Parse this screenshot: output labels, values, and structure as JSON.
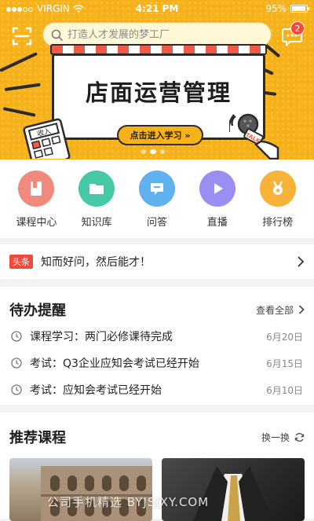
{
  "status_bar": {
    "carrier": "VIRGIN",
    "time": "4:21 PM",
    "battery": "95%",
    "battery_level": 0.95
  },
  "header": {
    "search_placeholder": "打造人才发展的梦工厂",
    "message_badge": "2"
  },
  "banner": {
    "title": "店面运营管理",
    "button_label": "点击进入学习 »",
    "calc_label": "收入",
    "mic_label": "TALK"
  },
  "categories": [
    {
      "label": "课程中心",
      "icon": "course-book-icon",
      "color": "#f08a7e"
    },
    {
      "label": "知识库",
      "icon": "folder-icon",
      "color": "#45c9a6"
    },
    {
      "label": "问答",
      "icon": "chat-bubble-icon",
      "color": "#5fb2ee"
    },
    {
      "label": "直播",
      "icon": "play-icon",
      "color": "#9a8ef2"
    },
    {
      "label": "排行榜",
      "icon": "medal-icon",
      "color": "#f7b23a"
    }
  ],
  "headline": {
    "tag": "头条",
    "text": "知而好问，然后能才！"
  },
  "todo": {
    "title": "待办提醒",
    "view_all": "查看全部",
    "items": [
      {
        "text": "课程学习：两门必修课待完成",
        "date": "6月20日"
      },
      {
        "text": "考试：Q3企业应知会考试已经开始",
        "date": "6月15日"
      },
      {
        "text": "考试：应知会考试已经开始",
        "date": "6月10日"
      }
    ]
  },
  "recommend": {
    "title": "推荐课程",
    "refresh": "换一换"
  },
  "watermark": "公司手机精选 BYJSJXY.COM"
}
